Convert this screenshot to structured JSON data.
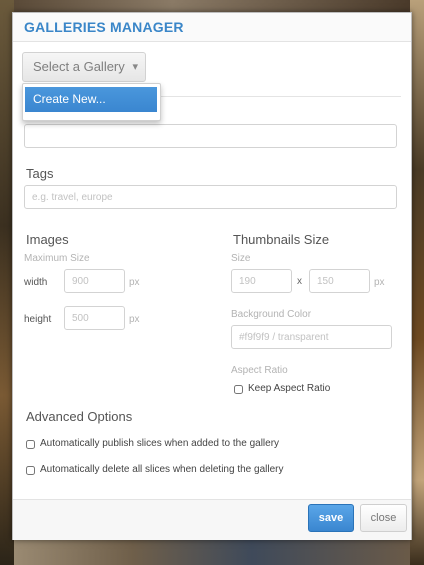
{
  "modal": {
    "title": "GALLERIES MANAGER"
  },
  "gallery_select": {
    "label": "Select a Gallery",
    "caret": "▾",
    "options": [
      "Create New..."
    ]
  },
  "fields": {
    "tags_label": "Tags",
    "tags_placeholder": "e.g. travel, europe",
    "name_value": ""
  },
  "images": {
    "title": "Images",
    "max_size_label": "Maximum Size",
    "width_label": "width",
    "width_placeholder": "900",
    "height_label": "height",
    "height_placeholder": "500",
    "unit": "px"
  },
  "thumbnails": {
    "title": "Thumbnails Size",
    "size_label": "Size",
    "w_placeholder": "190",
    "h_placeholder": "150",
    "x_sep": "x",
    "unit": "px",
    "bg_label": "Background Color",
    "bg_placeholder": "#f9f9f9 / transparent",
    "aspect_label": "Aspect Ratio",
    "keep_aspect_label": "Keep Aspect Ratio"
  },
  "advanced": {
    "title": "Advanced Options",
    "opt1": "Automatically publish slices when added to the gallery",
    "opt2": "Automatically delete all slices when deleting the gallery"
  },
  "footer": {
    "save_label": "save",
    "close_label": "close"
  },
  "colors": {
    "accent": "#3a86c8",
    "primary_button": "#3a86d0"
  }
}
